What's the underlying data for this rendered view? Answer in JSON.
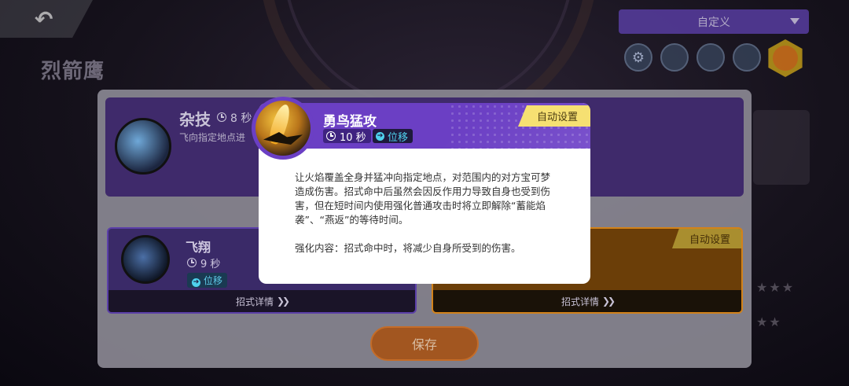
{
  "header": {
    "pokemon_name": "烈箭鹰",
    "dropdown_value": "自定义"
  },
  "top_move": {
    "name": "杂技",
    "cooldown": "8 秒",
    "description": "飞向指定地点进"
  },
  "left_move": {
    "name": "飞翔",
    "cooldown": "9 秒",
    "tag": "位移",
    "detail_label": "招式详情"
  },
  "right_move": {
    "auto_label": "自动设置",
    "detail_label": "招式详情"
  },
  "save_label": "保存",
  "popup": {
    "title": "勇鸟猛攻",
    "cooldown": "10 秒",
    "tag": "位移",
    "auto_label": "自动设置",
    "description": "让火焰覆盖全身并猛冲向指定地点，对范围内的对方宝可梦造成伤害。招式命中后虽然会因反作用力导致自身也受到伤害，但在短时间内使用强化普通攻击时将立即解除“蓄能焰袭”、“燕返”的等待时间。",
    "enhance": "强化内容：招式命中时，将减少自身所受到的伤害。",
    "header_color": "#6b3fc4",
    "auto_color": "#f6e072"
  }
}
